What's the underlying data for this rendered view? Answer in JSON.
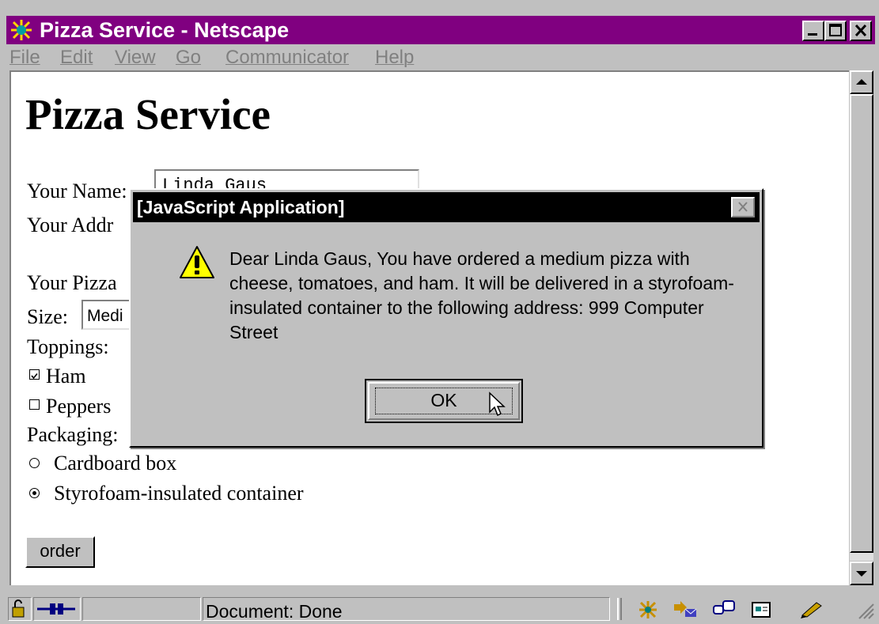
{
  "window": {
    "title": "Pizza Service - Netscape"
  },
  "menu": [
    "File",
    "Edit",
    "View",
    "Go",
    "Communicator",
    "Help"
  ],
  "page": {
    "heading": "Pizza Service",
    "name_label": "Your Name:",
    "name_value": "Linda Gaus",
    "address_label": "Your Addr",
    "pizza_label": "Your Pizza",
    "size_label": "Size:",
    "size_value": "Medi",
    "toppings_label": "Toppings:",
    "toppings": [
      {
        "label": "Ham",
        "checked": true
      },
      {
        "label": "Peppers",
        "checked": false
      }
    ],
    "packaging_label": "Packaging:",
    "packaging": [
      {
        "label": "Cardboard box",
        "selected": false
      },
      {
        "label": "Styrofoam-insulated container",
        "selected": true
      }
    ],
    "order_button": "order"
  },
  "dialog": {
    "title": "[JavaScript Application]",
    "message": "Dear Linda Gaus, You have ordered a medium pizza with cheese, tomatoes, and ham.  It will be delivered in a styrofoam-insulated container to the following address: 999 Computer Street",
    "ok_label": "OK"
  },
  "status": {
    "text": "Document: Done"
  },
  "icons": [
    "app-icon",
    "minimize-icon",
    "maximize-icon",
    "close-icon",
    "warning-icon",
    "lock-icon",
    "connection-icon",
    "navigator-icon",
    "mail-icon",
    "discussion-icon",
    "composer-icon",
    "edit-icon",
    "cursor-icon",
    "resize-grip-icon"
  ],
  "colors": {
    "titlebar": "#800080",
    "dialog_titlebar": "#000000",
    "face": "#c0c0c0",
    "warning": "#ffff00"
  }
}
